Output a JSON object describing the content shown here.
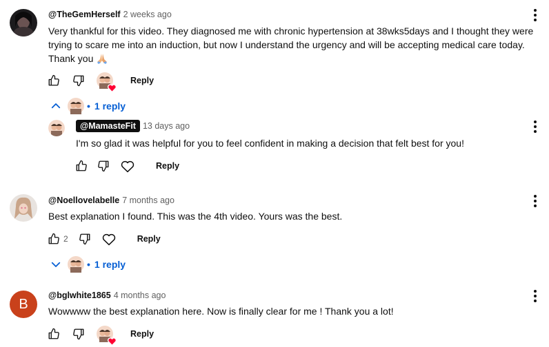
{
  "comments": [
    {
      "author": "@TheGemHerself",
      "time": "2 weeks ago",
      "text_lines": [
        "Very thankful for this video. They diagnosed me with chronic hypertension at 38wks5days and I thought they were",
        "trying to scare me into an induction, but now I understand the urgency and will be accepting medical care today.",
        "Thank you"
      ],
      "emoji": "folded-hands-emoji",
      "like_count": "",
      "reply_label": "Reply",
      "creator_hearted": true,
      "replies_toggle": {
        "label": "1 reply",
        "expanded": true
      },
      "replies": [
        {
          "author": "@MamasteFit",
          "is_owner": true,
          "time": "13 days ago",
          "text": "I'm so glad it was helpful for you to feel confident in making a decision that felt best for you!",
          "reply_label": "Reply"
        }
      ]
    },
    {
      "author": "@Noellovelabelle",
      "time": "7 months ago",
      "text": "Best explanation I found. This was the 4th video. Yours was the best.",
      "like_count": "2",
      "reply_label": "Reply",
      "creator_hearted": false,
      "replies_toggle": {
        "label": "1 reply",
        "expanded": false
      }
    },
    {
      "author": "@bglwhite1865",
      "avatar_letter": "B",
      "time": "4 months ago",
      "text": "Wowwww the best explanation here. Now is finally clear for me ! Thank you a lot!",
      "like_count": "",
      "reply_label": "Reply",
      "creator_hearted": true
    }
  ],
  "colors": {
    "link_blue": "#065fd4",
    "text_primary": "#0f0f0f",
    "text_secondary": "#606060",
    "heart_red": "#ff0033",
    "letter_avatar_bg": "#c9411b"
  }
}
